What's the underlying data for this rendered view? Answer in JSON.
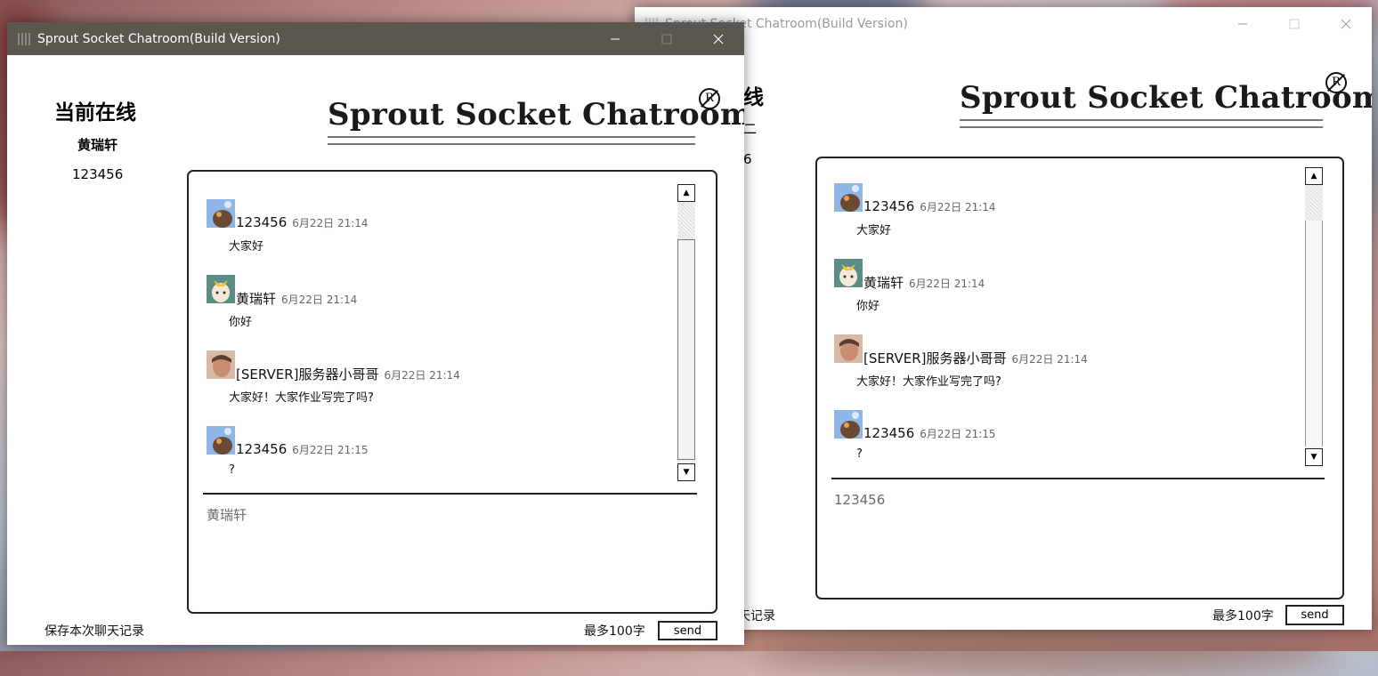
{
  "front": {
    "title": "Sprout Socket Chatroom(Build Version)",
    "online_title": "当前在线",
    "online_users": [
      "黄瑞轩",
      "123456"
    ],
    "brand": "Sprout Socket Chatroom",
    "brand_mark": "R",
    "messages": [
      {
        "name": "123456",
        "time": "6月22日 21:14",
        "text": "大家好",
        "avatar": "cat-avatar"
      },
      {
        "name": "黄瑞轩",
        "time": "6月22日 21:14",
        "text": "你好",
        "avatar": "girl-avatar"
      },
      {
        "name": "[SERVER]服务器小哥哥",
        "time": "6月22日 21:14",
        "text": "大家好！大家作业写完了吗?",
        "avatar": "boy-avatar"
      },
      {
        "name": "123456",
        "time": "6月22日 21:15",
        "text": "?",
        "avatar": "cat-avatar"
      }
    ],
    "input_value": "黄瑞轩",
    "save_label": "保存本次聊天记录",
    "limit_label": "最多100字",
    "send_label": "send"
  },
  "back": {
    "title": "Sprout Socket Chatroom(Build Version)",
    "online_title_partial": "线",
    "online_users_partial": [
      "二",
      "6"
    ],
    "brand": "Sprout Socket Chatroom",
    "brand_mark": "R",
    "messages": [
      {
        "name": "123456",
        "time": "6月22日 21:14",
        "text": "大家好",
        "avatar": "cat-avatar"
      },
      {
        "name": "黄瑞轩",
        "time": "6月22日 21:14",
        "text": "你好",
        "avatar": "girl-avatar"
      },
      {
        "name": "[SERVER]服务器小哥哥",
        "time": "6月22日 21:14",
        "text": "大家好！大家作业写完了吗?",
        "avatar": "boy-avatar"
      },
      {
        "name": "123456",
        "time": "6月22日 21:15",
        "text": "?",
        "avatar": "cat-avatar"
      }
    ],
    "input_value": "123456",
    "save_label_partial": "天记录",
    "limit_label": "最多100字",
    "send_label": "send"
  },
  "colors": {
    "front_titlebar": "#5c5650",
    "back_titlebar": "#ffffff"
  }
}
